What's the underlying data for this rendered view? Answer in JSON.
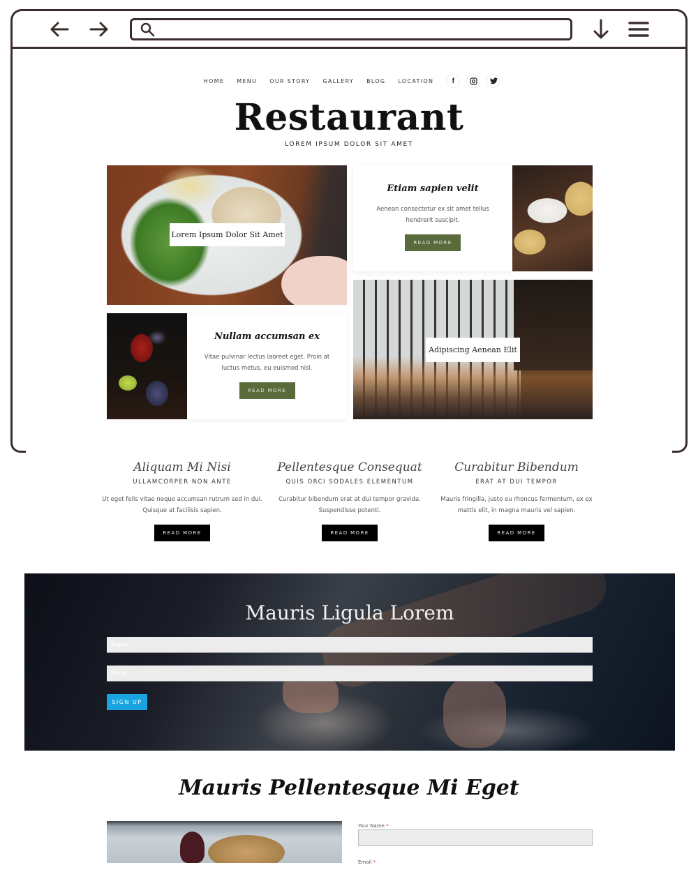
{
  "browser": {
    "back_icon": "arrow-left-icon",
    "forward_icon": "arrow-right-icon",
    "search_icon": "search-icon",
    "url_value": "",
    "download_icon": "download-arrow-icon",
    "menu_icon": "hamburger-menu-icon"
  },
  "nav": {
    "items": [
      "HOME",
      "MENU",
      "OUR STORY",
      "GALLERY",
      "BLOG",
      "LOCATION"
    ],
    "social": [
      {
        "icon": "facebook-icon",
        "glyph": "f"
      },
      {
        "icon": "instagram-icon",
        "glyph": "◎"
      },
      {
        "icon": "twitter-icon",
        "glyph": "✦"
      }
    ]
  },
  "hero": {
    "title": "Restaurant",
    "tagline": "LOREM IPSUM DOLOR SIT AMET"
  },
  "grid": {
    "tile1_label": "Lorem Ipsum Dolor Sit Amet",
    "card1": {
      "title": "Etiam sapien velit",
      "text": "Aenean consectetur ex sit amet tellus hendrerit suscipit.",
      "button": "READ MORE"
    },
    "card2": {
      "title": "Nullam accumsan ex",
      "text": "Vitae pulvinar lectus laoreet eget. Proin at luctus metus, eu euismod nisl.",
      "button": "READ MORE"
    },
    "tile2_label": "Adipiscing Aenean Elit"
  },
  "features": [
    {
      "title": "Aliquam Mi Nisi",
      "subtitle": "ULLAMCORPER NON ANTE",
      "text": "Ut eget felis vitae neque accumsan rutrum sed in dui. Quisque at facilisis sapien.",
      "button": "READ MORE"
    },
    {
      "title": "Pellentesque Consequat",
      "subtitle": "QUIS ORCI SODALES ELEMENTUM",
      "text": "Curabitur bibendum erat at dui tempor gravida. Suspendisse potenti.",
      "button": "READ MORE"
    },
    {
      "title": "Curabitur Bibendum",
      "subtitle": "ERAT AT DUI TEMPOR",
      "text": "Mauris fringilla, justo eu rhoncus fermentum, ex ex mattis elit, in magna mauris vel sapien.",
      "button": "READ MORE"
    }
  ],
  "signup": {
    "title": "Mauris Ligula Lorem",
    "name_placeholder": "Name",
    "email_placeholder": "Email",
    "button": "SIGN UP"
  },
  "contact": {
    "title": "Mauris Pellentesque Mi Eget",
    "name_label": "Your Name",
    "email_label": "Email",
    "required_mark": "*"
  },
  "colors": {
    "frame": "#3a2e2c",
    "green_button": "#5a6b3b",
    "blue_button": "#17a4e0",
    "required": "#e0245e"
  }
}
